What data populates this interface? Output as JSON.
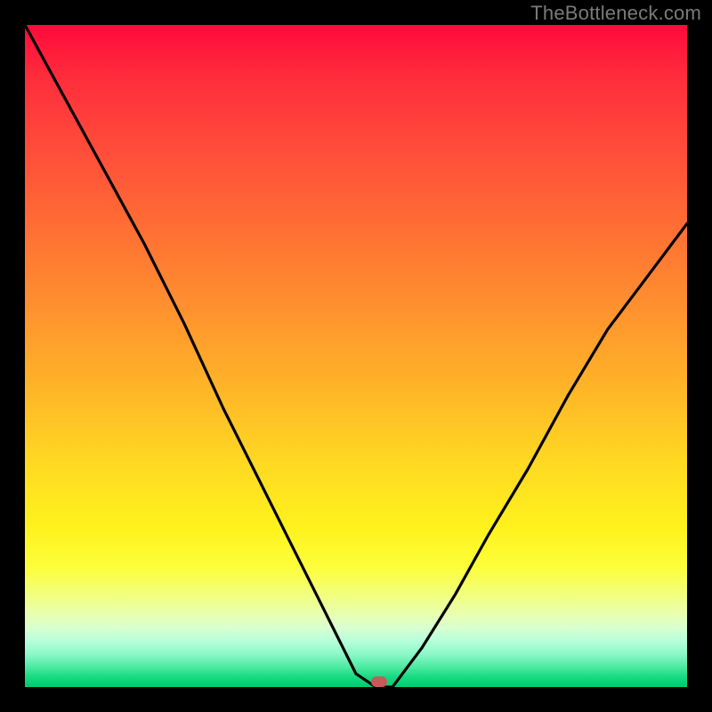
{
  "watermark": "TheBottleneck.com",
  "marker": {
    "x_frac": 0.535,
    "y_frac": 0.992
  },
  "colors": {
    "background": "#000000",
    "curve": "#000000",
    "marker": "#c85a5a",
    "watermark": "#7a7a7a"
  },
  "chart_data": {
    "type": "line",
    "title": "",
    "xlabel": "",
    "ylabel": "",
    "xlim": [
      0,
      1
    ],
    "ylim": [
      0,
      1
    ],
    "series": [
      {
        "name": "left-branch",
        "x": [
          0.0,
          0.06,
          0.12,
          0.18,
          0.24,
          0.3,
          0.35,
          0.4,
          0.44,
          0.47,
          0.5,
          0.53
        ],
        "values": [
          1.0,
          0.89,
          0.78,
          0.67,
          0.55,
          0.42,
          0.32,
          0.22,
          0.14,
          0.08,
          0.02,
          0.0
        ]
      },
      {
        "name": "valley-floor",
        "x": [
          0.53,
          0.555
        ],
        "values": [
          0.0,
          0.0
        ]
      },
      {
        "name": "right-branch",
        "x": [
          0.555,
          0.6,
          0.65,
          0.7,
          0.76,
          0.82,
          0.88,
          0.94,
          1.0
        ],
        "values": [
          0.0,
          0.06,
          0.14,
          0.23,
          0.33,
          0.44,
          0.54,
          0.62,
          0.7
        ]
      }
    ],
    "annotations": [
      {
        "type": "marker",
        "x": 0.535,
        "y": 0.008,
        "label": ""
      }
    ]
  }
}
